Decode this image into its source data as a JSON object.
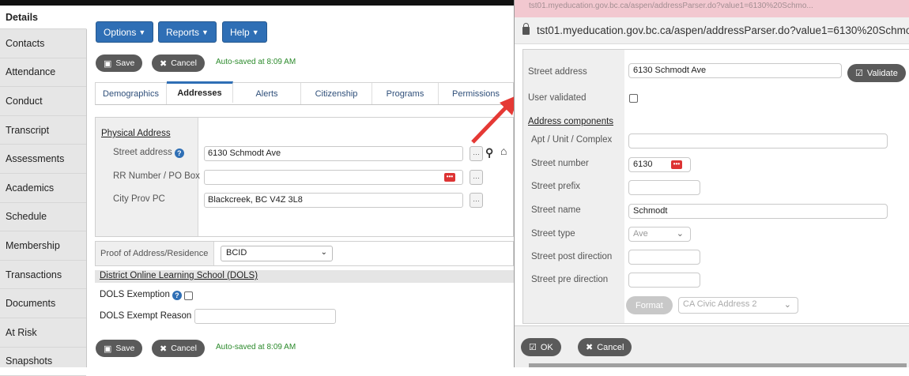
{
  "sidebar": {
    "items": [
      "Details",
      "Contacts",
      "Attendance",
      "Conduct",
      "Transcript",
      "Assessments",
      "Academics",
      "Schedule",
      "Membership",
      "Transactions",
      "Documents",
      "At Risk",
      "Snapshots"
    ]
  },
  "menu": {
    "options": "Options",
    "reports": "Reports",
    "help": "Help"
  },
  "toolbar": {
    "save": "Save",
    "cancel": "Cancel",
    "autosave": "Auto-saved at 8:09 AM"
  },
  "tabs": [
    "Demographics",
    "Addresses",
    "Alerts",
    "Citizenship",
    "Programs",
    "Permissions"
  ],
  "physical_address": {
    "title": "Physical Address",
    "street_label": "Street address",
    "street_value": "6130 Schmodt Ave",
    "rr_label": "RR Number / PO Box",
    "rr_value": "",
    "city_label": "City Prov PC",
    "city_value": "Blackcreek, BC V4Z 3L8"
  },
  "proof": {
    "label": "Proof of Address/Residence",
    "value": "BCID"
  },
  "dols": {
    "title": "District Online Learning School (DOLS)",
    "exemption_label": "DOLS Exemption",
    "exempt_reason_label": "DOLS Exempt Reason",
    "exempt_reason_value": ""
  },
  "popup": {
    "url": "tst01.myeducation.gov.bc.ca/aspen/addressParser.do?value1=6130%20Schmo...",
    "street_address_label": "Street address",
    "street_address_value": "6130 Schmodt Ave",
    "validate": "Validate",
    "user_validated_label": "User validated",
    "components_title": "Address components",
    "apt_label": "Apt / Unit / Complex",
    "street_number_label": "Street number",
    "street_number_value": "6130",
    "street_prefix_label": "Street prefix",
    "street_name_label": "Street name",
    "street_name_value": "Schmodt",
    "street_type_label": "Street type",
    "street_type_value": "Ave",
    "post_direction_label": "Street post direction",
    "pre_direction_label": "Street pre direction",
    "format_button": "Format",
    "format_value": "CA Civic Address 2",
    "ok": "OK",
    "cancel": "Cancel"
  },
  "colors": {
    "accent": "#2f6fb5",
    "autosave": "#2b8a2b",
    "annotation_arrow": "#e53935"
  }
}
